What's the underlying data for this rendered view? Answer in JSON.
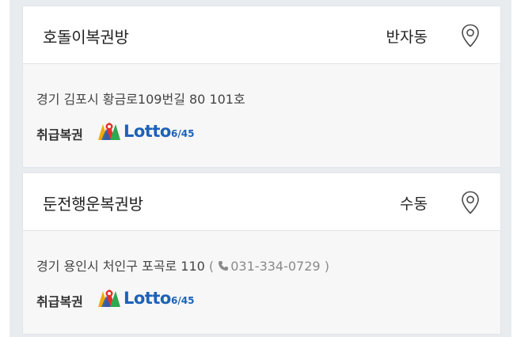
{
  "stores": [
    {
      "name": "호돌이복권방",
      "dong": "반자동",
      "address": "경기 김포시 황금로109번길 80 101호",
      "phone": "",
      "product_label": "취급복권",
      "product_logo": {
        "word": "Lotto",
        "sub": "6/45"
      },
      "icon": "map-pin-icon"
    },
    {
      "name": "둔전행운복권방",
      "dong": "수동",
      "address": "경기 용인시 처인구 포곡로 110",
      "phone": "031-334-0729",
      "phone_open": "(",
      "phone_close": ")",
      "product_label": "취급복권",
      "product_logo": {
        "word": "Lotto",
        "sub": "6/45"
      },
      "icon": "map-pin-icon"
    }
  ],
  "colors": {
    "lotto_blue": "#1d62b8",
    "card_header_bg": "#ffffff",
    "card_body_bg": "#f7f7f7",
    "page_bg": "#e9ecef"
  }
}
